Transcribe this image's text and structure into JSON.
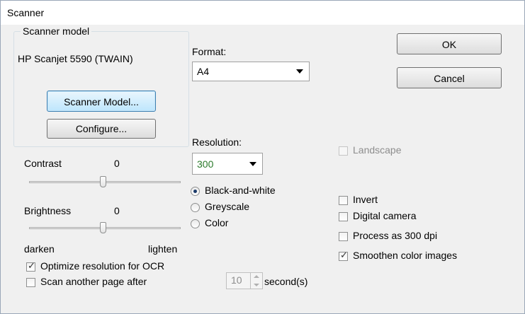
{
  "window": {
    "title": "Scanner"
  },
  "scanner_group": {
    "label": "Scanner model",
    "model_name": "HP Scanjet 5590 (TWAIN)",
    "scanner_model_button": "Scanner Model...",
    "configure_button": "Configure..."
  },
  "format": {
    "label": "Format:",
    "value": "A4"
  },
  "resolution": {
    "label": "Resolution:",
    "value": "300"
  },
  "color_mode": {
    "options": [
      "Black-and-white",
      "Greyscale",
      "Color"
    ],
    "selected": "Black-and-white"
  },
  "sliders": {
    "contrast": {
      "label": "Contrast",
      "value": "0",
      "level": 0.5
    },
    "brightness": {
      "label": "Brightness",
      "value": "0",
      "level": 0.5
    },
    "left_label": "darken",
    "right_label": "lighten"
  },
  "buttons": {
    "ok": "OK",
    "cancel": "Cancel"
  },
  "options": {
    "landscape": {
      "label": "Landscape",
      "checked": false,
      "enabled": false
    },
    "invert": {
      "label": "Invert",
      "checked": false
    },
    "digital_camera": {
      "label": "Digital camera",
      "checked": false
    },
    "process_300": {
      "label": "Process as 300 dpi",
      "checked": false
    },
    "smoothen": {
      "label": "Smoothen color images",
      "checked": true
    },
    "optimize_ocr": {
      "label": "Optimize resolution for OCR",
      "checked": true
    },
    "scan_another": {
      "label": "Scan another page after",
      "checked": false
    }
  },
  "delay": {
    "value": "10",
    "unit": "second(s)"
  }
}
